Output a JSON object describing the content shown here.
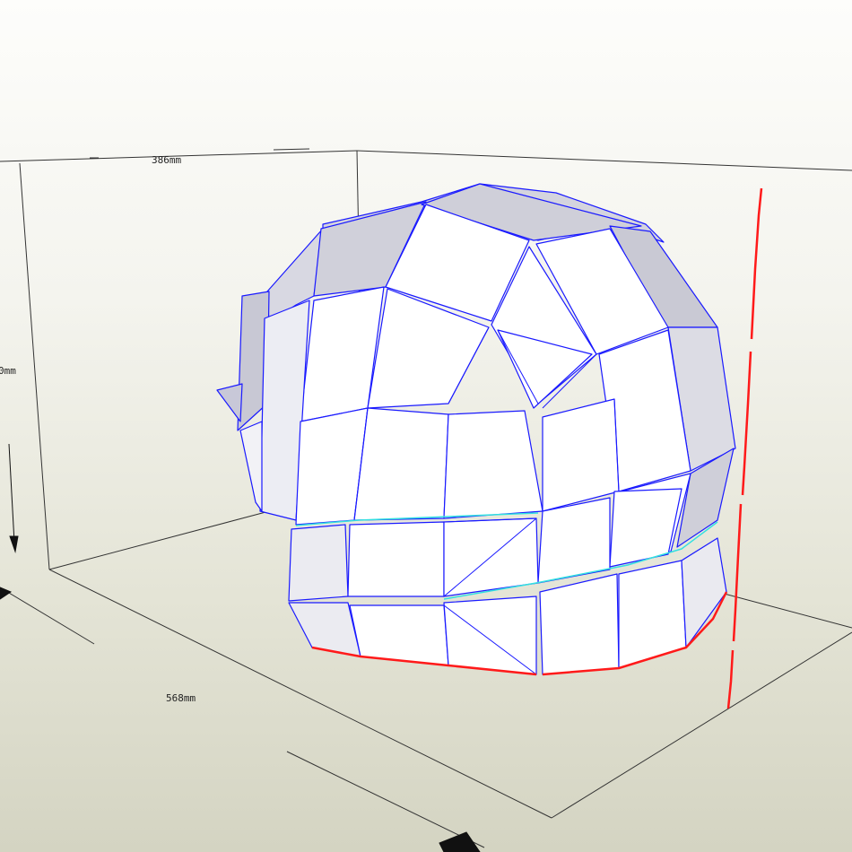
{
  "viewport": {
    "view_mode": "3D perspective",
    "background": "#f4f4ee"
  },
  "dimensions": {
    "width": "386mm",
    "height_partial": "0mm",
    "depth": "568mm"
  },
  "model": {
    "face_color": "#ffffff",
    "shade_color": "#c9c9d6",
    "edge_color": "#1a1aff",
    "seam_color": "#ff1a1a",
    "fold_color": "#33e0e0"
  }
}
